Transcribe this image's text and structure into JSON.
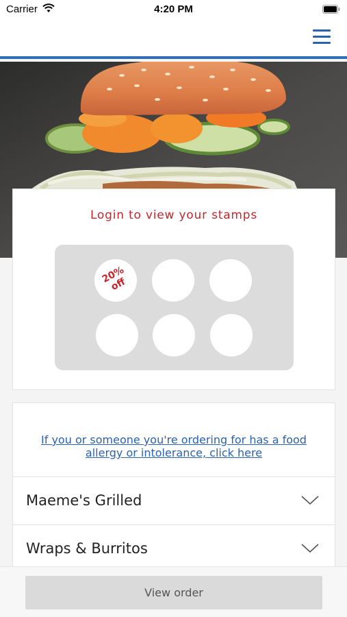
{
  "status_bar": {
    "carrier": "Carrier",
    "time": "4:20 PM"
  },
  "header": {
    "menu_icon": "hamburger-menu-icon",
    "accent_color": "#2f6db5"
  },
  "loyalty": {
    "title": "Login to view your stamps",
    "title_color": "#c6262b",
    "reward_stamp_text": "20%\noff",
    "stamp_count": 6
  },
  "allergy": {
    "link_text": "If you or someone you're ordering for has a food allergy or intolerance, click here"
  },
  "menu": {
    "categories": [
      {
        "label": "Maeme's Grilled",
        "icon": "chevron-down-icon"
      },
      {
        "label": "Wraps & Burritos",
        "icon": "chevron-down-icon"
      }
    ]
  },
  "footer": {
    "view_order_label": "View order"
  }
}
